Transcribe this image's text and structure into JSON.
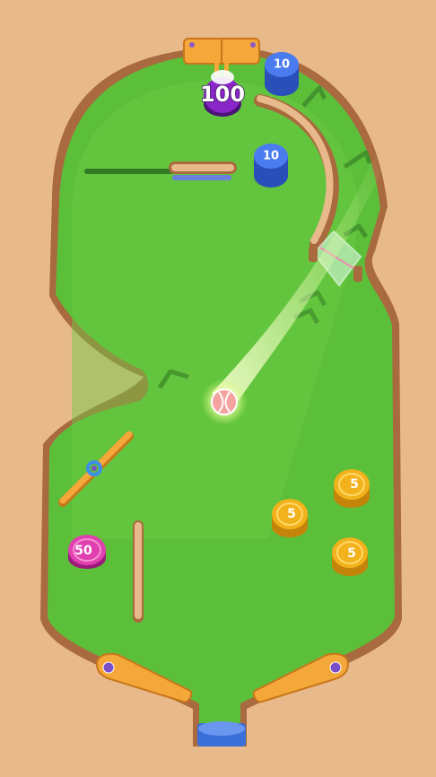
{
  "game": {
    "target_score": "100",
    "bumpers": [
      {
        "id": "blue-top",
        "label": "10",
        "color": "#3f6fe0"
      },
      {
        "id": "blue-mid",
        "label": "10",
        "color": "#3f6fe0"
      },
      {
        "id": "pink",
        "label": "50",
        "color": "#e040b0"
      },
      {
        "id": "gold-1",
        "label": "5",
        "color": "#f2b21c"
      },
      {
        "id": "gold-2",
        "label": "5",
        "color": "#f2b21c"
      },
      {
        "id": "gold-3",
        "label": "5",
        "color": "#f2b21c"
      }
    ],
    "colors": {
      "table_wood": "#e8b98a",
      "field_green": "#5cbf3a",
      "rail_orange": "#f4a83a",
      "target_purple": "#7a1fb8",
      "ball": "#f4a3a0"
    }
  }
}
